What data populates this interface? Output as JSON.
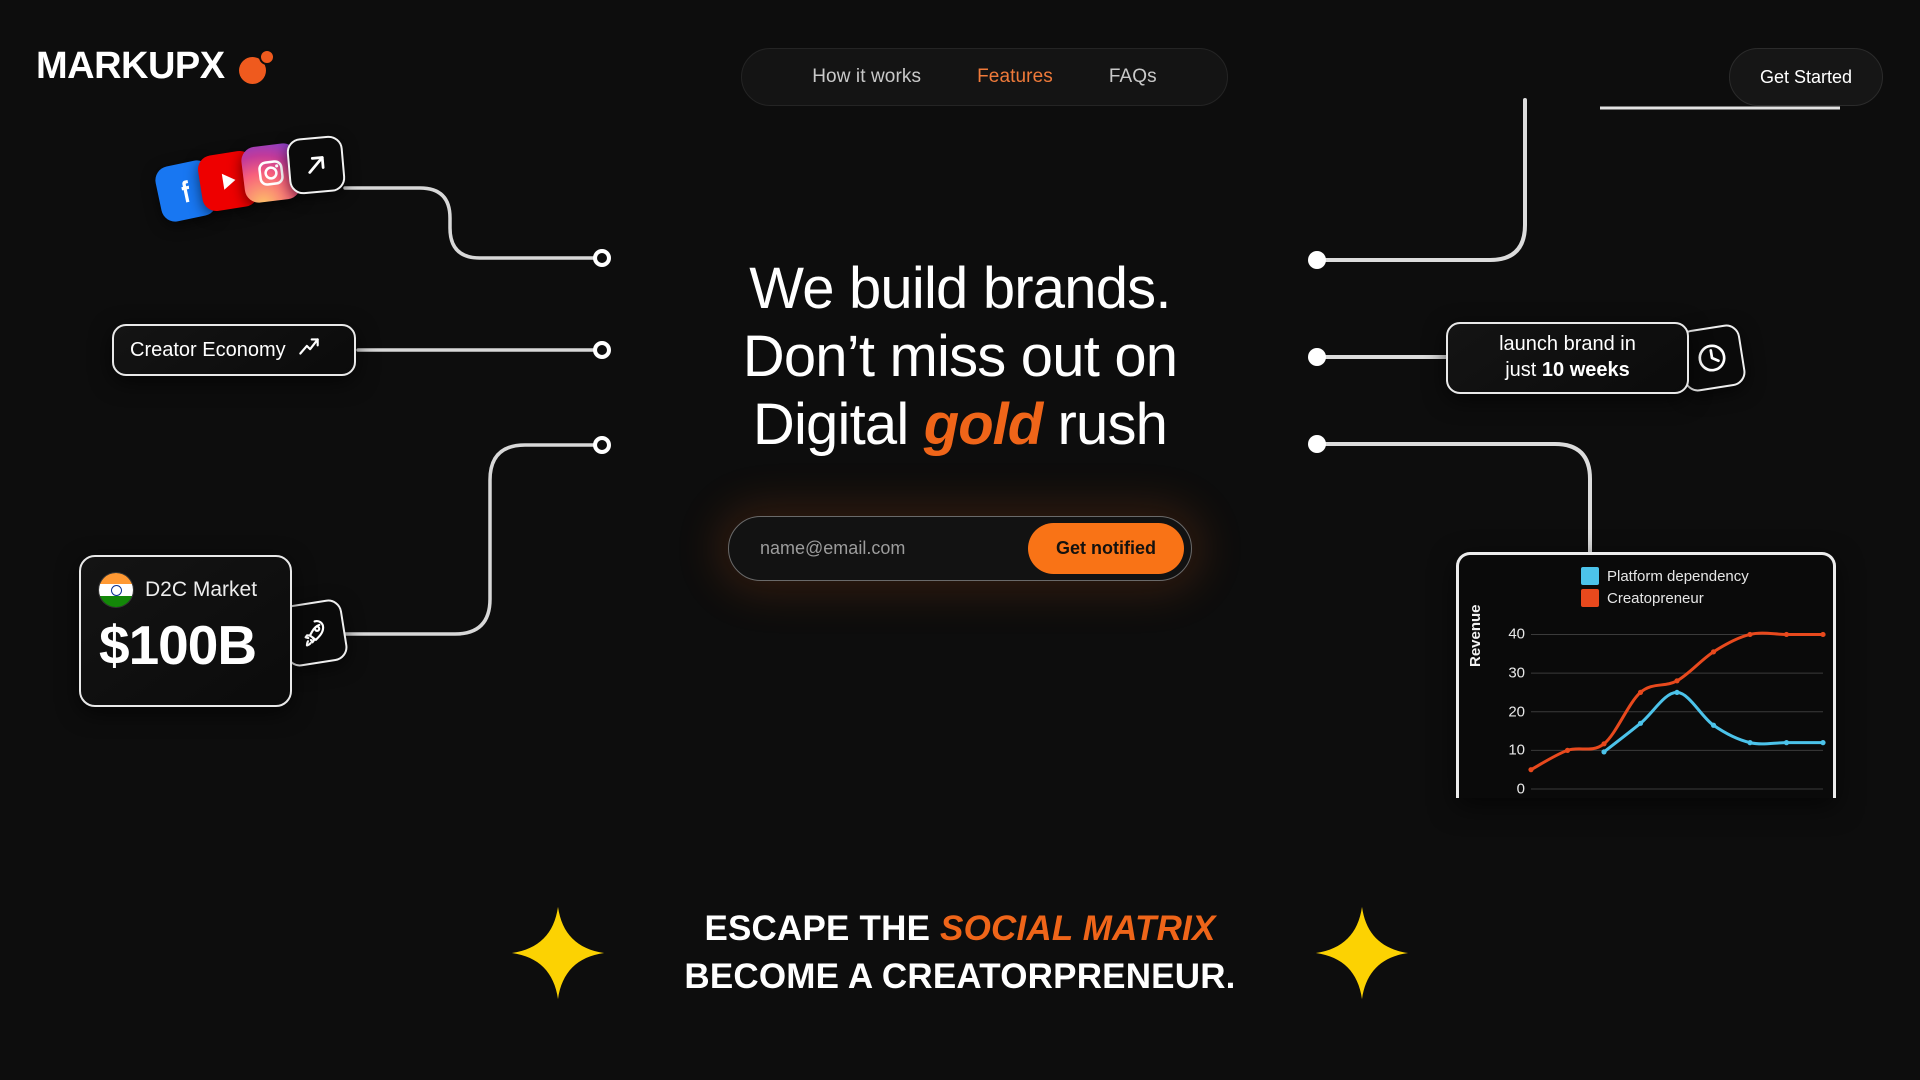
{
  "brand": {
    "name": "MARKUPX",
    "logo_mark": "orange-molecule-dots",
    "accent_color": "#ef6519"
  },
  "nav": {
    "items": [
      {
        "label": "How it works",
        "active": false
      },
      {
        "label": "Features",
        "active": true
      },
      {
        "label": "FAQs",
        "active": false
      }
    ],
    "cta_label": "Get Started"
  },
  "hero": {
    "line1": "We build brands.",
    "line2": "Don’t miss out on",
    "line3_pre": "Digital ",
    "line3_accent": "gold",
    "line3_post": " rush"
  },
  "signup": {
    "placeholder": "name@email.com",
    "value": "",
    "button_label": "Get notified",
    "button_color": "#f97316"
  },
  "left_cards": {
    "social_icons": [
      {
        "name": "facebook-icon",
        "color": "#1877f2"
      },
      {
        "name": "youtube-icon",
        "color": "#ee0000"
      },
      {
        "name": "instagram-icon",
        "color": "#c23a9a"
      },
      {
        "name": "arrow-up-right-icon",
        "color": "#0a0a0a"
      }
    ],
    "creator_economy": {
      "label": "Creator Economy",
      "icon": "trending-up-icon"
    },
    "d2c": {
      "flag": "india-flag-icon",
      "label": "D2C Market",
      "value": "$100B",
      "badge_icon": "rocket-icon"
    }
  },
  "right_cards": {
    "launch": {
      "line1": "launch brand in",
      "line2_pre": "just ",
      "line2_strong": "10 weeks",
      "badge_icon": "clock-icon"
    }
  },
  "banner": {
    "line1_pre": "ESCAPE THE ",
    "line1_accent": "SOCIAL MATRIX",
    "line2": "BECOME A CREATORPRENEUR.",
    "sparkle_color": "#fcd202",
    "sparkle_icon": "four-point-star-icon"
  },
  "chart_data": {
    "type": "line",
    "title": "",
    "xlabel": "",
    "ylabel": "Revenue",
    "ylim": [
      0,
      44
    ],
    "yticks": [
      0,
      10,
      20,
      30,
      40
    ],
    "grid": true,
    "legend_position": "top",
    "x": [
      1,
      2,
      3,
      4,
      5,
      6,
      7,
      8,
      9
    ],
    "series": [
      {
        "name": "Platform dependency",
        "color": "#4cc3ea",
        "x": [
          3,
          4,
          5,
          6,
          7,
          8,
          9
        ],
        "values": [
          9.6,
          17,
          25,
          16.5,
          12,
          12,
          12
        ]
      },
      {
        "name": "Creatopreneur",
        "color": "#e8491d",
        "x": [
          1,
          2,
          3,
          4,
          5,
          6,
          7,
          8,
          9
        ],
        "values": [
          5,
          10,
          11.7,
          25,
          28,
          35.5,
          40,
          40,
          40
        ]
      }
    ]
  }
}
